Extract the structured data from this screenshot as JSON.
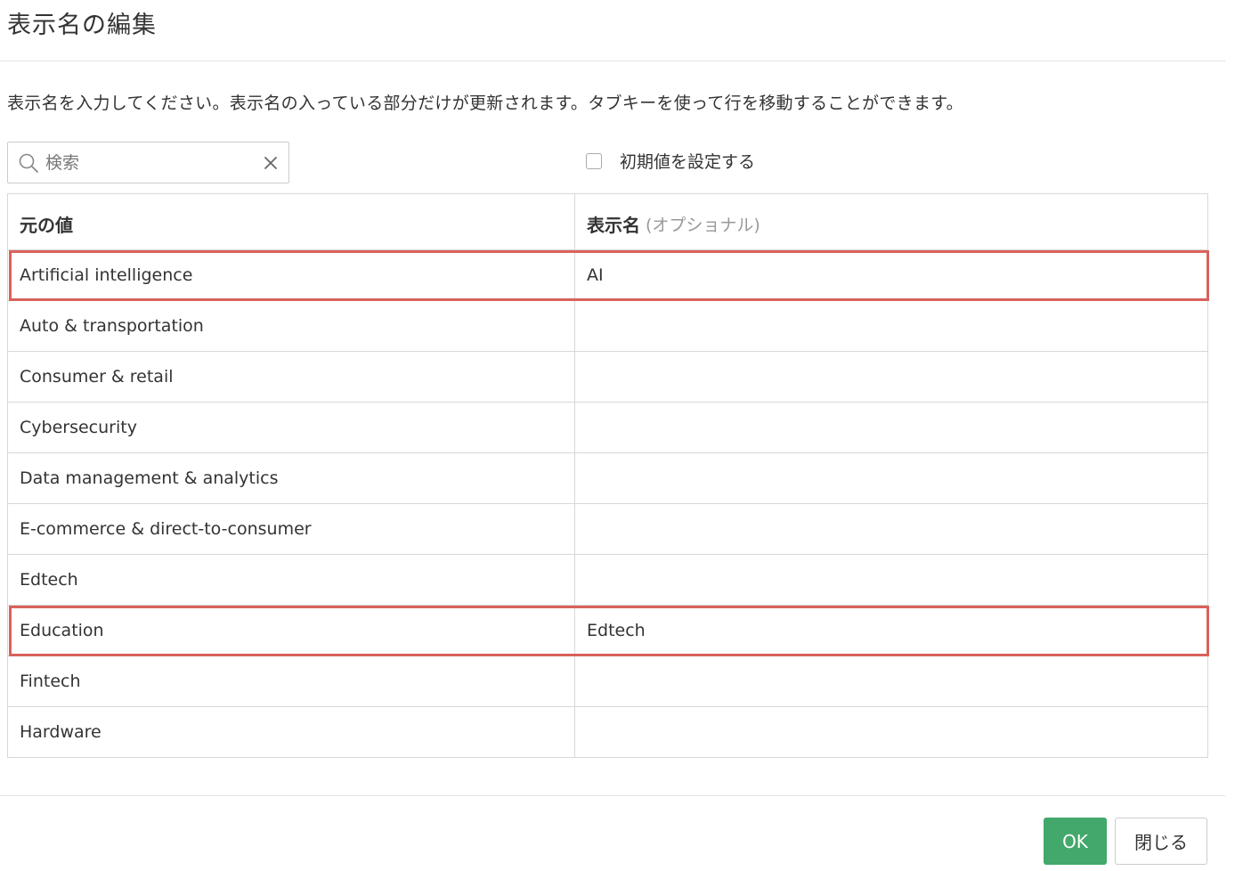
{
  "dialog": {
    "title": "表示名の編集",
    "description": "表示名を入力してください。表示名の入っている部分だけが更新されます。タブキーを使って行を移動することができます。"
  },
  "search": {
    "placeholder": "検索",
    "value": ""
  },
  "default_checkbox": {
    "label": "初期値を設定する",
    "checked": false
  },
  "table": {
    "col_original": "元の値",
    "col_display": "表示名",
    "col_display_optional": "(オプショナル)",
    "rows": [
      {
        "original": "Artificial intelligence",
        "display": "AI",
        "highlighted": true
      },
      {
        "original": "Auto & transportation",
        "display": "",
        "highlighted": false
      },
      {
        "original": "Consumer & retail",
        "display": "",
        "highlighted": false
      },
      {
        "original": "Cybersecurity",
        "display": "",
        "highlighted": false
      },
      {
        "original": "Data management & analytics",
        "display": "",
        "highlighted": false
      },
      {
        "original": "E-commerce & direct-to-consumer",
        "display": "",
        "highlighted": false
      },
      {
        "original": "Edtech",
        "display": "",
        "highlighted": false
      },
      {
        "original": "Education",
        "display": "Edtech",
        "highlighted": true
      },
      {
        "original": "Fintech",
        "display": "",
        "highlighted": false
      },
      {
        "original": "Hardware",
        "display": "",
        "highlighted": false
      }
    ]
  },
  "buttons": {
    "ok": "OK",
    "close": "閉じる"
  },
  "colors": {
    "primary": "#43a86b",
    "highlight": "#d9625c"
  }
}
